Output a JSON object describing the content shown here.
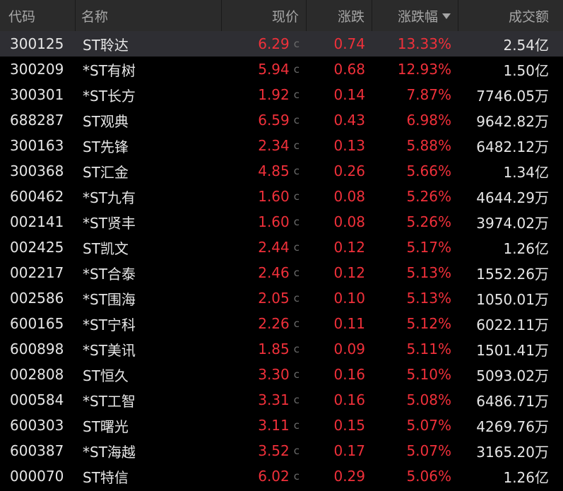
{
  "colors": {
    "background": "#000000",
    "header_bg": "#2b2b2b",
    "selected_row_bg": "#2e2e33",
    "rise": "#f0303a",
    "text": "#e6e6e6",
    "header_text": "#a6a6a6",
    "badge": "#6b6b6b"
  },
  "header": {
    "code": "代码",
    "name": "名称",
    "price": "现价",
    "change": "涨跌",
    "change_pct": "涨跌幅",
    "volume": "成交额",
    "sort_icon": "caret-down-icon"
  },
  "rows": [
    {
      "code": "300125",
      "name": "ST聆达",
      "price": "6.29",
      "badge": "c",
      "change": "0.74",
      "pct": "13.33%",
      "volume": "2.54亿",
      "selected": true
    },
    {
      "code": "300209",
      "name": "*ST有树",
      "price": "5.94",
      "badge": "c",
      "change": "0.68",
      "pct": "12.93%",
      "volume": "1.50亿"
    },
    {
      "code": "300301",
      "name": "*ST长方",
      "price": "1.92",
      "badge": "c",
      "change": "0.14",
      "pct": "7.87%",
      "volume": "7746.05万"
    },
    {
      "code": "688287",
      "name": "ST观典",
      "price": "6.59",
      "badge": "c",
      "change": "0.43",
      "pct": "6.98%",
      "volume": "9642.82万"
    },
    {
      "code": "300163",
      "name": "ST先锋",
      "price": "2.34",
      "badge": "c",
      "change": "0.13",
      "pct": "5.88%",
      "volume": "6482.12万"
    },
    {
      "code": "300368",
      "name": "ST汇金",
      "price": "4.85",
      "badge": "c",
      "change": "0.26",
      "pct": "5.66%",
      "volume": "1.34亿"
    },
    {
      "code": "600462",
      "name": "*ST九有",
      "price": "1.60",
      "badge": "c",
      "change": "0.08",
      "pct": "5.26%",
      "volume": "4644.29万"
    },
    {
      "code": "002141",
      "name": "*ST贤丰",
      "price": "1.60",
      "badge": "c",
      "change": "0.08",
      "pct": "5.26%",
      "volume": "3974.02万"
    },
    {
      "code": "002425",
      "name": "ST凯文",
      "price": "2.44",
      "badge": "c",
      "change": "0.12",
      "pct": "5.17%",
      "volume": "1.26亿"
    },
    {
      "code": "002217",
      "name": "*ST合泰",
      "price": "2.46",
      "badge": "c",
      "change": "0.12",
      "pct": "5.13%",
      "volume": "1552.26万"
    },
    {
      "code": "002586",
      "name": "*ST围海",
      "price": "2.05",
      "badge": "c",
      "change": "0.10",
      "pct": "5.13%",
      "volume": "1050.01万"
    },
    {
      "code": "600165",
      "name": "*ST宁科",
      "price": "2.26",
      "badge": "c",
      "change": "0.11",
      "pct": "5.12%",
      "volume": "6022.11万"
    },
    {
      "code": "600898",
      "name": "*ST美讯",
      "price": "1.85",
      "badge": "c",
      "change": "0.09",
      "pct": "5.11%",
      "volume": "1501.41万"
    },
    {
      "code": "002808",
      "name": "ST恒久",
      "price": "3.30",
      "badge": "c",
      "change": "0.16",
      "pct": "5.10%",
      "volume": "5093.02万"
    },
    {
      "code": "000584",
      "name": "*ST工智",
      "price": "3.31",
      "badge": "c",
      "change": "0.16",
      "pct": "5.08%",
      "volume": "6486.71万"
    },
    {
      "code": "600303",
      "name": "ST曙光",
      "price": "3.11",
      "badge": "c",
      "change": "0.15",
      "pct": "5.07%",
      "volume": "4269.76万"
    },
    {
      "code": "600387",
      "name": "*ST海越",
      "price": "3.52",
      "badge": "c",
      "change": "0.17",
      "pct": "5.07%",
      "volume": "3165.20万"
    },
    {
      "code": "000070",
      "name": "ST特信",
      "price": "6.02",
      "badge": "c",
      "change": "0.29",
      "pct": "5.06%",
      "volume": "1.26亿"
    }
  ]
}
